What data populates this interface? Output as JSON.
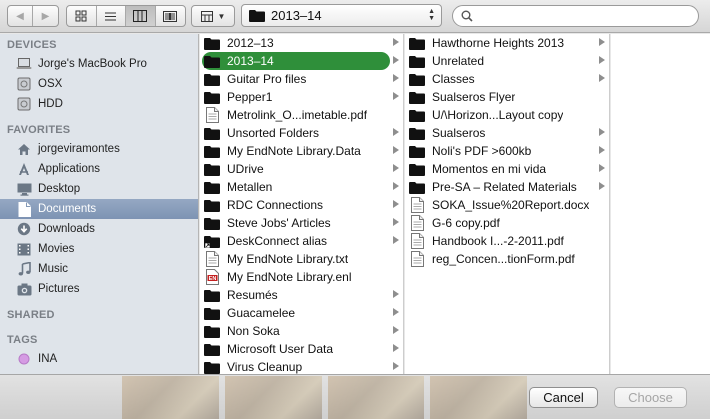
{
  "toolbar": {
    "path_label": "2013–14",
    "search_placeholder": ""
  },
  "sidebar": {
    "sections": [
      {
        "title": "DEVICES",
        "items": [
          {
            "label": "Jorge's MacBook Pro",
            "icon": "laptop-icon"
          },
          {
            "label": "OSX",
            "icon": "hard-drive-icon"
          },
          {
            "label": "HDD",
            "icon": "hard-drive-icon"
          }
        ]
      },
      {
        "title": "FAVORITES",
        "items": [
          {
            "label": "jorgeviramontes",
            "icon": "home-icon"
          },
          {
            "label": "Applications",
            "icon": "applications-icon"
          },
          {
            "label": "Desktop",
            "icon": "desktop-icon"
          },
          {
            "label": "Documents",
            "icon": "documents-icon",
            "selected": true
          },
          {
            "label": "Downloads",
            "icon": "downloads-icon"
          },
          {
            "label": "Movies",
            "icon": "movies-icon"
          },
          {
            "label": "Music",
            "icon": "music-icon"
          },
          {
            "label": "Pictures",
            "icon": "pictures-icon"
          }
        ]
      },
      {
        "title": "SHARED",
        "items": []
      },
      {
        "title": "TAGS",
        "items": [
          {
            "label": "INA",
            "icon": "tag-dot-icon"
          }
        ]
      }
    ]
  },
  "columns": [
    [
      {
        "name": "2012–13",
        "type": "folder",
        "arrow": true
      },
      {
        "name": "2013–14",
        "type": "folder",
        "arrow": true,
        "selected": true
      },
      {
        "name": "Guitar Pro files",
        "type": "folder",
        "arrow": true
      },
      {
        "name": "Pepper1",
        "type": "folder",
        "arrow": true
      },
      {
        "name": "Metrolink_O...imetable.pdf",
        "type": "file",
        "arrow": false
      },
      {
        "name": "Unsorted Folders",
        "type": "folder",
        "arrow": true
      },
      {
        "name": "My EndNote Library.Data",
        "type": "folder",
        "arrow": true
      },
      {
        "name": "UDrive",
        "type": "folder",
        "arrow": true
      },
      {
        "name": "Metallen",
        "type": "folder",
        "arrow": true
      },
      {
        "name": "RDC Connections",
        "type": "folder",
        "arrow": true
      },
      {
        "name": "Steve Jobs' Articles",
        "type": "folder",
        "arrow": true
      },
      {
        "name": "DeskConnect alias",
        "type": "alias",
        "arrow": true
      },
      {
        "name": "My EndNote Library.txt",
        "type": "file",
        "arrow": false
      },
      {
        "name": "My EndNote Library.enl",
        "type": "endnote",
        "arrow": false
      },
      {
        "name": "Resumés",
        "type": "folder",
        "arrow": true
      },
      {
        "name": "Guacamelee",
        "type": "folder",
        "arrow": true
      },
      {
        "name": "Non Soka",
        "type": "folder",
        "arrow": true
      },
      {
        "name": "Microsoft User Data",
        "type": "folder",
        "arrow": true
      },
      {
        "name": "Virus Cleanup",
        "type": "folder",
        "arrow": true
      }
    ],
    [
      {
        "name": "Hawthorne Heights 2013",
        "type": "folder",
        "arrow": true
      },
      {
        "name": "Unrelated",
        "type": "folder",
        "arrow": true
      },
      {
        "name": "Classes",
        "type": "folder",
        "arrow": true
      },
      {
        "name": "Sualseros Flyer",
        "type": "folder",
        "arrow": false
      },
      {
        "name": "U/\\Horizon...Layout copy",
        "type": "folder",
        "arrow": false
      },
      {
        "name": "Sualseros",
        "type": "folder",
        "arrow": true
      },
      {
        "name": "Noli's PDF >600kb",
        "type": "folder",
        "arrow": true
      },
      {
        "name": "Momentos en mi vida",
        "type": "folder",
        "arrow": true
      },
      {
        "name": "Pre-SA – Related Materials",
        "type": "folder",
        "arrow": true
      },
      {
        "name": "SOKA_Issue%20Report.docx",
        "type": "file",
        "arrow": false
      },
      {
        "name": "G-6 copy.pdf",
        "type": "file",
        "arrow": false
      },
      {
        "name": "Handbook I...-2-2011.pdf",
        "type": "file",
        "arrow": false
      },
      {
        "name": "reg_Concen...tionForm.pdf",
        "type": "file",
        "arrow": false
      }
    ]
  ],
  "buttons": {
    "cancel": "Cancel",
    "choose": "Choose"
  },
  "colors": {
    "selection_green": "#2f8f3a",
    "sidebar_selection": "#8499b6"
  }
}
